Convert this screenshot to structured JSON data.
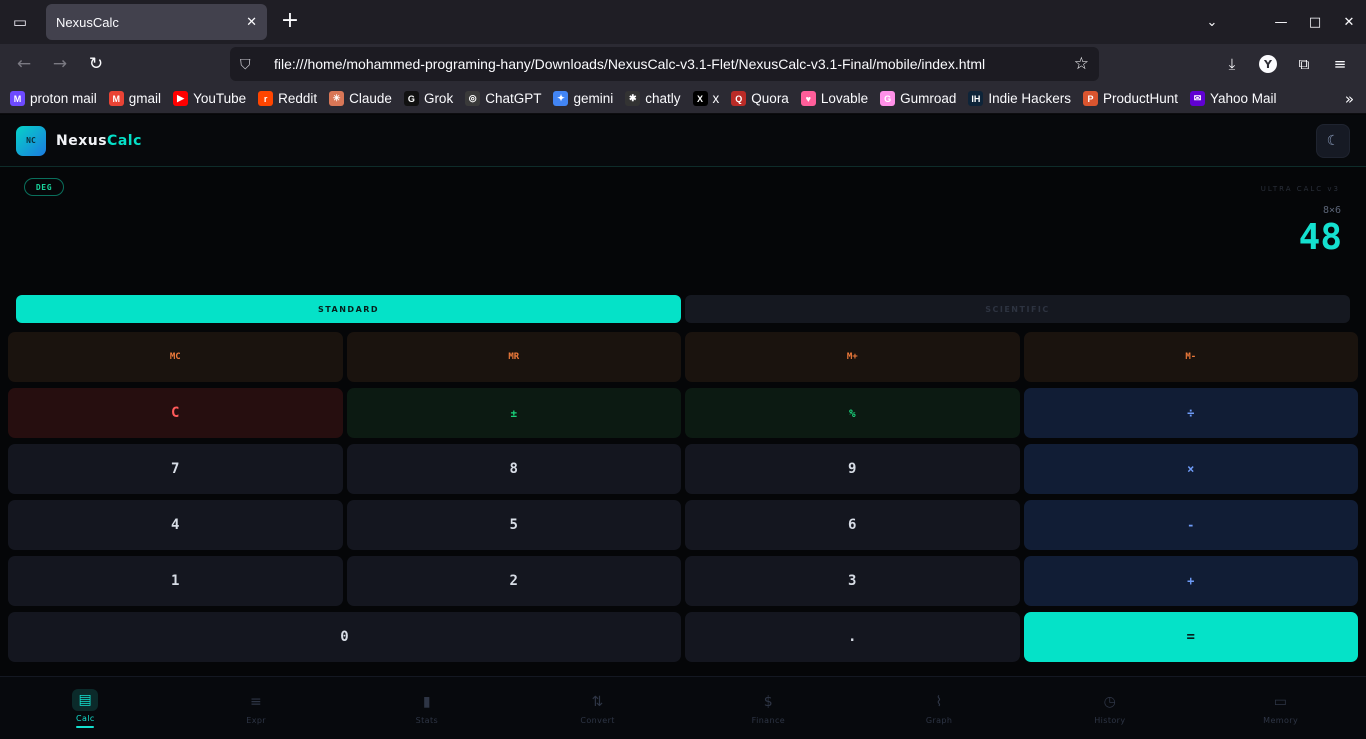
{
  "browser": {
    "tab_title": "NexusCalc",
    "url": "file:///home/mohammed-programing-hany/Downloads/NexusCalc-v3.1-Flet/NexusCalc-v3.1-Final/mobile/index.html",
    "bookmarks": [
      {
        "label": "proton mail",
        "color": "#6d4aff",
        "glyph": "M"
      },
      {
        "label": "gmail",
        "color": "#ea4335",
        "glyph": "M"
      },
      {
        "label": "YouTube",
        "color": "#ff0000",
        "glyph": "▶"
      },
      {
        "label": "Reddit",
        "color": "#ff4500",
        "glyph": "r"
      },
      {
        "label": "Claude",
        "color": "#d97757",
        "glyph": "✳"
      },
      {
        "label": "Grok",
        "color": "#111111",
        "glyph": "G"
      },
      {
        "label": "ChatGPT",
        "color": "#3a3a3a",
        "glyph": "◎"
      },
      {
        "label": "gemini",
        "color": "#4285f4",
        "glyph": "✦"
      },
      {
        "label": "chatly",
        "color": "#333333",
        "glyph": "✱"
      },
      {
        "label": "x",
        "color": "#000000",
        "glyph": "X"
      },
      {
        "label": "Quora",
        "color": "#b92b27",
        "glyph": "Q"
      },
      {
        "label": "Lovable",
        "color": "#ff5e9a",
        "glyph": "♥"
      },
      {
        "label": "Gumroad",
        "color": "#ff90e8",
        "glyph": "G"
      },
      {
        "label": "Indie Hackers",
        "color": "#0e2439",
        "glyph": "IH"
      },
      {
        "label": "ProductHunt",
        "color": "#da552f",
        "glyph": "P"
      },
      {
        "label": "Yahoo Mail",
        "color": "#6001d2",
        "glyph": "✉"
      }
    ]
  },
  "app": {
    "logo_text": "NC",
    "brand_part1": "Nexus",
    "brand_part2": "Calc",
    "angle_mode": "DEG",
    "version_label": "ULTRA CALC v3",
    "expression": "8×6",
    "result": "48",
    "modes": [
      "STANDARD",
      "SCIENTIFIC"
    ],
    "active_mode": "STANDARD",
    "keys": {
      "mc": "MC",
      "mr": "MR",
      "mplus": "M+",
      "mminus": "M-",
      "clear": "C",
      "sign": "±",
      "percent": "%",
      "divide": "÷",
      "n7": "7",
      "n8": "8",
      "n9": "9",
      "multiply": "×",
      "n4": "4",
      "n5": "5",
      "n6": "6",
      "minus": "-",
      "n1": "1",
      "n2": "2",
      "n3": "3",
      "plus": "+",
      "n0": "0",
      "dot": ".",
      "equals": "="
    },
    "nav": [
      {
        "label": "Calc",
        "icon": "calculator-icon",
        "active": true
      },
      {
        "label": "Expr",
        "icon": "expression-icon"
      },
      {
        "label": "Stats",
        "icon": "bar-chart-icon"
      },
      {
        "label": "Convert",
        "icon": "swap-icon"
      },
      {
        "label": "Finance",
        "icon": "dollar-icon"
      },
      {
        "label": "Graph",
        "icon": "pulse-icon"
      },
      {
        "label": "History",
        "icon": "clock-icon"
      },
      {
        "label": "Memory",
        "icon": "memory-icon"
      }
    ],
    "colors": {
      "accent": "#05e2c8",
      "memory": "#f07b3b",
      "clear": "#ff5a5a",
      "function": "#19d27a",
      "operator": "#6e9bf7"
    }
  }
}
